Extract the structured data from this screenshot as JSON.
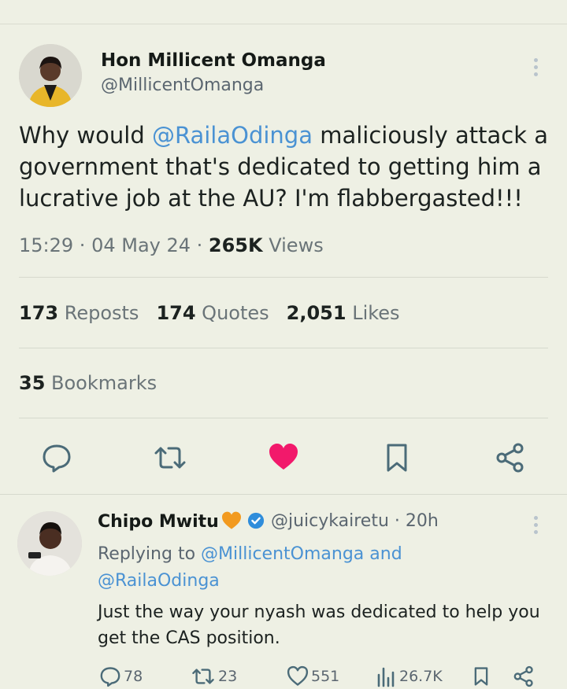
{
  "tweet": {
    "author_name": "Hon Millicent Omanga",
    "author_handle": "@MillicentOmanga",
    "text_parts": {
      "before": "Why would ",
      "mention": "@RailaOdinga",
      "after": " maliciously attack a government that's dedicated to getting him a lucrative job at the AU? I'm flabbergasted!!!"
    },
    "time": "15:29",
    "dot1": " · ",
    "date": "04 May 24",
    "dot2": " · ",
    "views_count": "265K",
    "views_label": " Views",
    "reposts_count": "173",
    "reposts_label": " Reposts",
    "quotes_count": "174",
    "quotes_label": " Quotes",
    "likes_count": "2,051",
    "likes_label": " Likes",
    "bookmarks_count": "35",
    "bookmarks_label": " Bookmarks"
  },
  "actions": {
    "reply_icon": "speech-bubble-icon",
    "repost_icon": "repost-arrows-icon",
    "like_icon": "heart-filled-icon",
    "bookmark_icon": "bookmark-icon",
    "share_icon": "share-nodes-icon"
  },
  "reply": {
    "author_name": "Chipo Mwitu",
    "name_emoji": "orange-heart-icon",
    "verified_icon": "verified-badge-icon",
    "author_handle": "@juicykairetu",
    "dot": " · ",
    "age": "20h",
    "replying_prefix": "Replying to ",
    "replying_mention1": "@MillicentOmanga",
    "replying_and": " and",
    "replying_mention2": "@RailaOdinga",
    "text": "Just the way your nyash was dedicated to help you get the CAS position.",
    "replies_count": "78",
    "reposts_count": "23",
    "likes_count": "551",
    "views_count": "26.7K"
  },
  "colors": {
    "background": "#eef0e4",
    "mention": "#4a92d3",
    "like_active": "#f2196b",
    "icon": "#4b6b78",
    "verified": "#2f8ddb"
  }
}
